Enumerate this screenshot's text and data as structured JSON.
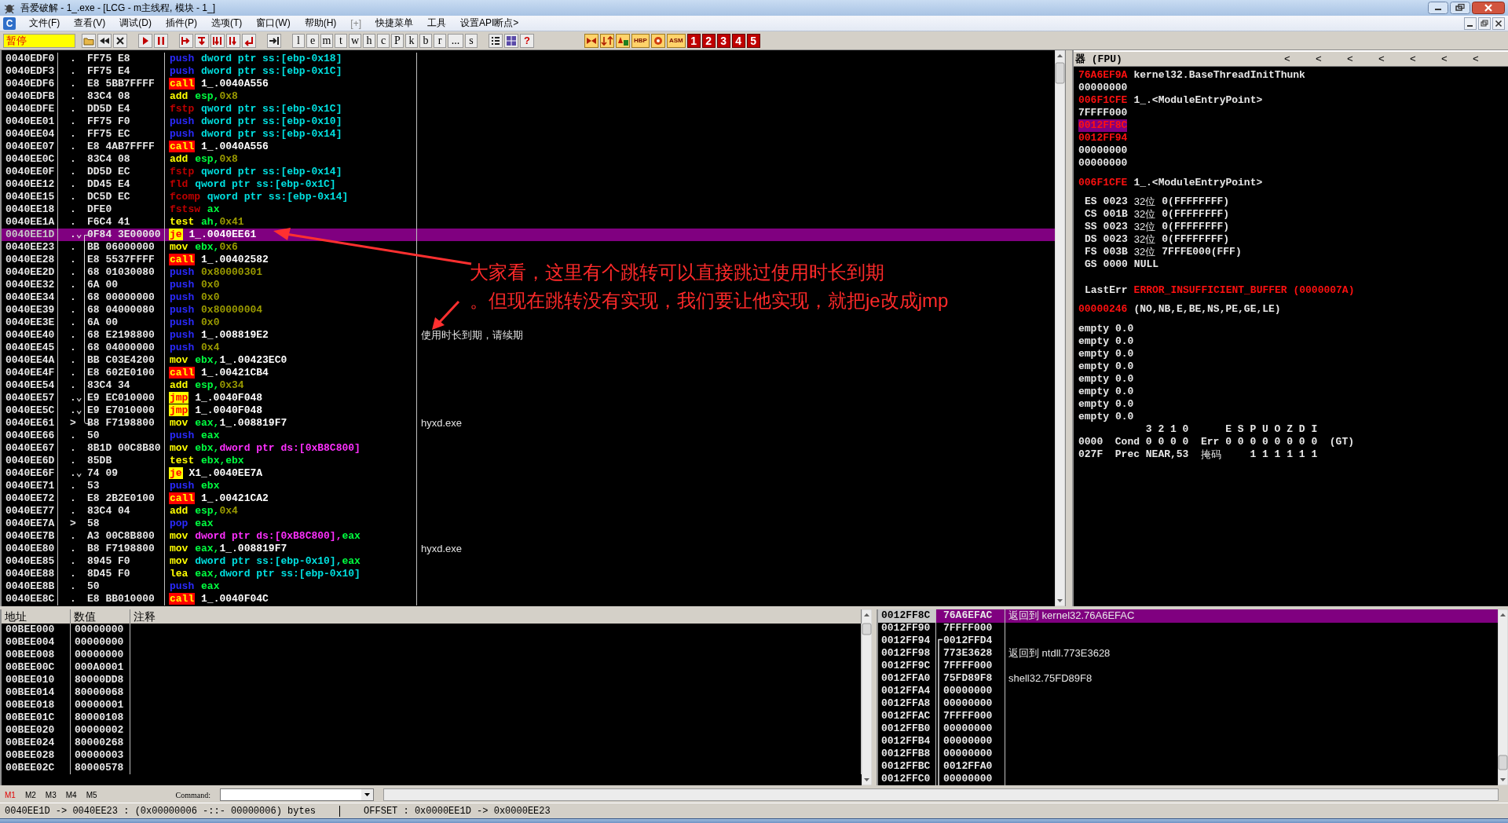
{
  "window": {
    "title": "吾爱破解 - 1_.exe - [LCG - m主线程, 模块 - 1_]"
  },
  "menu": {
    "icon_label": "C",
    "items": [
      "文件(F)",
      "查看(V)",
      "调试(D)",
      "插件(P)",
      "选项(T)",
      "窗口(W)",
      "帮助(H)",
      "[+]",
      "快捷菜单",
      "工具",
      "设置API断点>"
    ]
  },
  "toolbar": {
    "status": "暂停",
    "letter_buttons": [
      "l",
      "e",
      "m",
      "t",
      "w",
      "h",
      "c",
      "P",
      "k",
      "b",
      "r",
      "...",
      "s"
    ],
    "help_button": "?",
    "badge_buttons": [
      "HBP",
      "ASM"
    ],
    "number_buttons": [
      "1",
      "2",
      "3",
      "4",
      "5"
    ]
  },
  "disassembly": {
    "rows": [
      {
        "address": "0040EDF0",
        "marker": ".",
        "hex": "FF75 E8",
        "kind": "push",
        "mnemonic": "push",
        "operands": [
          {
            "text": "dword ptr ss:[ebp-0x18]",
            "kind": "stack"
          }
        ],
        "selected": false,
        "jump_source": false,
        "jump_target": false
      },
      {
        "address": "0040EDF3",
        "marker": ".",
        "hex": "FF75 E4",
        "kind": "push",
        "mnemonic": "push",
        "operands": [
          {
            "text": "dword ptr ss:[ebp-0x1C]",
            "kind": "stack"
          }
        ],
        "selected": false,
        "jump_source": false,
        "jump_target": false
      },
      {
        "address": "0040EDF6",
        "marker": ".",
        "hex": "E8 5BB7FFFF",
        "kind": "call",
        "mnemonic": "call",
        "operands": [
          {
            "text": "1_.0040A556",
            "kind": "addr"
          }
        ],
        "selected": false,
        "jump_source": false,
        "jump_target": false
      },
      {
        "address": "0040EDFB",
        "marker": ".",
        "hex": "83C4 08",
        "kind": "plain",
        "mnemonic": "add",
        "operands": [
          {
            "text": "esp,",
            "kind": "reg"
          },
          {
            "text": "0x8",
            "kind": "const"
          }
        ],
        "selected": false,
        "jump_source": false,
        "jump_target": false
      },
      {
        "address": "0040EDFE",
        "marker": ".",
        "hex": "DD5D E4",
        "kind": "fpu",
        "mnemonic": "fstp",
        "operands": [
          {
            "text": "qword ptr ss:[ebp-0x1C]",
            "kind": "stack"
          }
        ],
        "selected": false,
        "jump_source": false,
        "jump_target": false
      },
      {
        "address": "0040EE01",
        "marker": ".",
        "hex": "FF75 F0",
        "kind": "push",
        "mnemonic": "push",
        "operands": [
          {
            "text": "dword ptr ss:[ebp-0x10]",
            "kind": "stack"
          }
        ],
        "selected": false,
        "jump_source": false,
        "jump_target": false
      },
      {
        "address": "0040EE04",
        "marker": ".",
        "hex": "FF75 EC",
        "kind": "push",
        "mnemonic": "push",
        "operands": [
          {
            "text": "dword ptr ss:[ebp-0x14]",
            "kind": "stack"
          }
        ],
        "selected": false,
        "jump_source": false,
        "jump_target": false
      },
      {
        "address": "0040EE07",
        "marker": ".",
        "hex": "E8 4AB7FFFF",
        "kind": "call",
        "mnemonic": "call",
        "operands": [
          {
            "text": "1_.0040A556",
            "kind": "addr"
          }
        ],
        "selected": false,
        "jump_source": false,
        "jump_target": false
      },
      {
        "address": "0040EE0C",
        "marker": ".",
        "hex": "83C4 08",
        "kind": "plain",
        "mnemonic": "add",
        "operands": [
          {
            "text": "esp,",
            "kind": "reg"
          },
          {
            "text": "0x8",
            "kind": "const"
          }
        ],
        "selected": false,
        "jump_source": false,
        "jump_target": false
      },
      {
        "address": "0040EE0F",
        "marker": ".",
        "hex": "DD5D EC",
        "kind": "fpu",
        "mnemonic": "fstp",
        "operands": [
          {
            "text": "qword ptr ss:[ebp-0x14]",
            "kind": "stack"
          }
        ],
        "selected": false,
        "jump_source": false,
        "jump_target": false
      },
      {
        "address": "0040EE12",
        "marker": ".",
        "hex": "DD45 E4",
        "kind": "fpu",
        "mnemonic": "fld",
        "operands": [
          {
            "text": "qword ptr ss:[ebp-0x1C]",
            "kind": "stack"
          }
        ],
        "selected": false,
        "jump_source": false,
        "jump_target": false
      },
      {
        "address": "0040EE15",
        "marker": ".",
        "hex": "DC5D EC",
        "kind": "fpu",
        "mnemonic": "fcomp",
        "operands": [
          {
            "text": "qword ptr ss:[ebp-0x14]",
            "kind": "stack"
          }
        ],
        "selected": false,
        "jump_source": false,
        "jump_target": false
      },
      {
        "address": "0040EE18",
        "marker": ".",
        "hex": "DFE0",
        "kind": "fpu",
        "mnemonic": "fstsw",
        "operands": [
          {
            "text": "ax",
            "kind": "reg"
          }
        ],
        "selected": false,
        "jump_source": false,
        "jump_target": false
      },
      {
        "address": "0040EE1A",
        "marker": ".",
        "hex": "F6C4 41",
        "kind": "plain",
        "mnemonic": "test",
        "operands": [
          {
            "text": "ah,",
            "kind": "reg"
          },
          {
            "text": "0x41",
            "kind": "const"
          }
        ],
        "selected": false,
        "jump_source": false,
        "jump_target": false
      },
      {
        "address": "0040EE1D",
        "marker": ".⌄",
        "hex": "0F84 3E00000",
        "kind": "jump",
        "mnemonic": "je",
        "operands": [
          {
            "text": "1_.0040EE61",
            "kind": "addr"
          }
        ],
        "selected": true,
        "jump_source": true,
        "jump_target": false
      },
      {
        "address": "0040EE23",
        "marker": ".",
        "hex": "BB 06000000",
        "kind": "plain",
        "mnemonic": "mov",
        "operands": [
          {
            "text": "ebx,",
            "kind": "reg"
          },
          {
            "text": "0x6",
            "kind": "const"
          }
        ],
        "selected": false,
        "jump_source": false,
        "jump_target": false
      },
      {
        "address": "0040EE28",
        "marker": ".",
        "hex": "E8 5537FFFF",
        "kind": "call",
        "mnemonic": "call",
        "operands": [
          {
            "text": "1_.00402582",
            "kind": "addr"
          }
        ],
        "selected": false,
        "jump_source": false,
        "jump_target": false
      },
      {
        "address": "0040EE2D",
        "marker": ".",
        "hex": "68 01030080",
        "kind": "push",
        "mnemonic": "push",
        "operands": [
          {
            "text": "0x80000301",
            "kind": "const"
          }
        ],
        "selected": false,
        "jump_source": false,
        "jump_target": false
      },
      {
        "address": "0040EE32",
        "marker": ".",
        "hex": "6A 00",
        "kind": "push",
        "mnemonic": "push",
        "operands": [
          {
            "text": "0x0",
            "kind": "const"
          }
        ],
        "selected": false,
        "jump_source": false,
        "jump_target": false
      },
      {
        "address": "0040EE34",
        "marker": ".",
        "hex": "68 00000000",
        "kind": "push",
        "mnemonic": "push",
        "operands": [
          {
            "text": "0x0",
            "kind": "const"
          }
        ],
        "selected": false,
        "jump_source": false,
        "jump_target": false
      },
      {
        "address": "0040EE39",
        "marker": ".",
        "hex": "68 04000080",
        "kind": "push",
        "mnemonic": "push",
        "operands": [
          {
            "text": "0x80000004",
            "kind": "const"
          }
        ],
        "selected": false,
        "jump_source": false,
        "jump_target": false
      },
      {
        "address": "0040EE3E",
        "marker": ".",
        "hex": "6A 00",
        "kind": "push",
        "mnemonic": "push",
        "operands": [
          {
            "text": "0x0",
            "kind": "const"
          }
        ],
        "selected": false,
        "jump_source": false,
        "jump_target": false
      },
      {
        "address": "0040EE40",
        "marker": ".",
        "hex": "68 E2198800",
        "kind": "push",
        "mnemonic": "push",
        "operands": [
          {
            "text": "1_.008819E2",
            "kind": "addr"
          }
        ],
        "comment": "使用时长到期，请续期",
        "selected": false,
        "jump_source": false,
        "jump_target": false
      },
      {
        "address": "0040EE45",
        "marker": ".",
        "hex": "68 04000000",
        "kind": "push",
        "mnemonic": "push",
        "operands": [
          {
            "text": "0x4",
            "kind": "const"
          }
        ],
        "selected": false,
        "jump_source": false,
        "jump_target": false
      },
      {
        "address": "0040EE4A",
        "marker": ".",
        "hex": "BB C03E4200",
        "kind": "plain",
        "mnemonic": "mov",
        "operands": [
          {
            "text": "ebx,",
            "kind": "reg"
          },
          {
            "text": "1_.00423EC0",
            "kind": "addr"
          }
        ],
        "selected": false,
        "jump_source": false,
        "jump_target": false
      },
      {
        "address": "0040EE4F",
        "marker": ".",
        "hex": "E8 602E0100",
        "kind": "call",
        "mnemonic": "call",
        "operands": [
          {
            "text": "1_.00421CB4",
            "kind": "addr"
          }
        ],
        "selected": false,
        "jump_source": false,
        "jump_target": false
      },
      {
        "address": "0040EE54",
        "marker": ".",
        "hex": "83C4 34",
        "kind": "plain",
        "mnemonic": "add",
        "operands": [
          {
            "text": "esp,",
            "kind": "reg"
          },
          {
            "text": "0x34",
            "kind": "const"
          }
        ],
        "selected": false,
        "jump_source": false,
        "jump_target": false
      },
      {
        "address": "0040EE57",
        "marker": ".⌄",
        "hex": "E9 EC010000",
        "kind": "jump",
        "mnemonic": "jmp",
        "operands": [
          {
            "text": "1_.0040F048",
            "kind": "addr"
          }
        ],
        "selected": false,
        "jump_source": false,
        "jump_target": false
      },
      {
        "address": "0040EE5C",
        "marker": ".⌄",
        "hex": "E9 E7010000",
        "kind": "jump",
        "mnemonic": "jmp",
        "operands": [
          {
            "text": "1_.0040F048",
            "kind": "addr"
          }
        ],
        "selected": false,
        "jump_source": false,
        "jump_target": false
      },
      {
        "address": "0040EE61",
        "marker": ">",
        "hex": "B8 F7198800",
        "kind": "plain",
        "mnemonic": "mov",
        "operands": [
          {
            "text": "eax,",
            "kind": "reg"
          },
          {
            "text": "1_.008819F7",
            "kind": "addr"
          }
        ],
        "comment": "hyxd.exe",
        "selected": false,
        "jump_source": false,
        "jump_target": true
      },
      {
        "address": "0040EE66",
        "marker": ".",
        "hex": "50",
        "kind": "push",
        "mnemonic": "push",
        "operands": [
          {
            "text": "eax",
            "kind": "reg"
          }
        ],
        "selected": false,
        "jump_source": false,
        "jump_target": false
      },
      {
        "address": "0040EE67",
        "marker": ".",
        "hex": "8B1D 00C8B80",
        "kind": "plain",
        "mnemonic": "mov",
        "operands": [
          {
            "text": "ebx,",
            "kind": "reg"
          },
          {
            "text": "dword ptr ds:[0xB8C800]",
            "kind": "global"
          }
        ],
        "selected": false,
        "jump_source": false,
        "jump_target": false
      },
      {
        "address": "0040EE6D",
        "marker": ".",
        "hex": "85DB",
        "kind": "plain",
        "mnemonic": "test",
        "operands": [
          {
            "text": "ebx,ebx",
            "kind": "reg"
          }
        ],
        "selected": false,
        "jump_source": false,
        "jump_target": false
      },
      {
        "address": "0040EE6F",
        "marker": ".⌄",
        "hex": "74 09",
        "kind": "jump",
        "mnemonic": "je",
        "operands": [
          {
            "text": "X1_.0040EE7A",
            "kind": "addr"
          }
        ],
        "selected": false,
        "jump_source": false,
        "jump_target": false
      },
      {
        "address": "0040EE71",
        "marker": ".",
        "hex": "53",
        "kind": "push",
        "mnemonic": "push",
        "operands": [
          {
            "text": "ebx",
            "kind": "reg"
          }
        ],
        "selected": false,
        "jump_source": false,
        "jump_target": false
      },
      {
        "address": "0040EE72",
        "marker": ".",
        "hex": "E8 2B2E0100",
        "kind": "call",
        "mnemonic": "call",
        "operands": [
          {
            "text": "1_.00421CA2",
            "kind": "addr"
          }
        ],
        "selected": false,
        "jump_source": false,
        "jump_target": false
      },
      {
        "address": "0040EE77",
        "marker": ".",
        "hex": "83C4 04",
        "kind": "plain",
        "mnemonic": "add",
        "operands": [
          {
            "text": "esp,",
            "kind": "reg"
          },
          {
            "text": "0x4",
            "kind": "const"
          }
        ],
        "selected": false,
        "jump_source": false,
        "jump_target": false
      },
      {
        "address": "0040EE7A",
        "marker": ">",
        "hex": "58",
        "kind": "push",
        "mnemonic": "pop",
        "operands": [
          {
            "text": "eax",
            "kind": "reg"
          }
        ],
        "selected": false,
        "jump_source": false,
        "jump_target": false
      },
      {
        "address": "0040EE7B",
        "marker": ".",
        "hex": "A3 00C8B800",
        "kind": "plain",
        "mnemonic": "mov",
        "operands": [
          {
            "text": "dword ptr ds:[0xB8C800],",
            "kind": "global"
          },
          {
            "text": "eax",
            "kind": "reg"
          }
        ],
        "selected": false,
        "jump_source": false,
        "jump_target": false
      },
      {
        "address": "0040EE80",
        "marker": ".",
        "hex": "B8 F7198800",
        "kind": "plain",
        "mnemonic": "mov",
        "operands": [
          {
            "text": "eax,",
            "kind": "reg"
          },
          {
            "text": "1_.008819F7",
            "kind": "addr"
          }
        ],
        "comment": "hyxd.exe",
        "selected": false,
        "jump_source": false,
        "jump_target": false
      },
      {
        "address": "0040EE85",
        "marker": ".",
        "hex": "8945 F0",
        "kind": "plain",
        "mnemonic": "mov",
        "operands": [
          {
            "text": "dword ptr ss:[ebp-0x10],",
            "kind": "stack"
          },
          {
            "text": "eax",
            "kind": "reg"
          }
        ],
        "selected": false,
        "jump_source": false,
        "jump_target": false
      },
      {
        "address": "0040EE88",
        "marker": ".",
        "hex": "8D45 F0",
        "kind": "plain",
        "mnemonic": "lea",
        "operands": [
          {
            "text": "eax,",
            "kind": "reg"
          },
          {
            "text": "dword ptr ss:[ebp-0x10]",
            "kind": "stack"
          }
        ],
        "selected": false,
        "jump_source": false,
        "jump_target": false
      },
      {
        "address": "0040EE8B",
        "marker": ".",
        "hex": "50",
        "kind": "push",
        "mnemonic": "push",
        "operands": [
          {
            "text": "eax",
            "kind": "reg"
          }
        ],
        "selected": false,
        "jump_source": false,
        "jump_target": false
      },
      {
        "address": "0040EE8C",
        "marker": ".",
        "hex": "E8 BB010000",
        "kind": "call",
        "mnemonic": "call",
        "operands": [
          {
            "text": "1_.0040F04C",
            "kind": "addr"
          }
        ],
        "selected": false,
        "jump_source": false,
        "jump_target": false
      }
    ]
  },
  "annotation": {
    "lines": [
      "大家看，这里有个跳转可以直接跳过使用时长到期",
      "。但现在跳转没有实现，我们要让他实现，就把je改成jmp"
    ]
  },
  "registers": {
    "header": "器 (FPU)",
    "scroll_buttons": [
      "<",
      "<",
      "<",
      "<",
      "<",
      "<",
      "<"
    ],
    "general": [
      {
        "value": "76A6EF9A",
        "changed": true,
        "selected": false,
        "comment": "kernel32.BaseThreadInitThunk"
      },
      {
        "value": "00000000",
        "changed": false,
        "selected": false
      },
      {
        "value": "006F1CFE",
        "changed": true,
        "selected": false,
        "comment": "1_.<ModuleEntryPoint>"
      },
      {
        "value": "7FFFF000",
        "changed": false,
        "selected": false
      },
      {
        "value": "0012FF8C",
        "changed": true,
        "selected": true
      },
      {
        "value": "0012FF94",
        "changed": true,
        "selected": false
      },
      {
        "value": "00000000",
        "changed": false,
        "selected": false
      },
      {
        "value": "00000000",
        "changed": false,
        "selected": false
      }
    ],
    "eip": {
      "value": "006F1CFE",
      "changed": true,
      "comment": "1_.<ModuleEntryPoint>"
    },
    "segments": [
      {
        "name": "ES",
        "selector": "0023",
        "bits": "32位",
        "base": "0(FFFFFFFF)"
      },
      {
        "name": "CS",
        "selector": "001B",
        "bits": "32位",
        "base": "0(FFFFFFFF)"
      },
      {
        "name": "SS",
        "selector": "0023",
        "bits": "32位",
        "base": "0(FFFFFFFF)"
      },
      {
        "name": "DS",
        "selector": "0023",
        "bits": "32位",
        "base": "0(FFFFFFFF)"
      },
      {
        "name": "FS",
        "selector": "003B",
        "bits": "32位",
        "base": "7FFFE000(FFF)"
      },
      {
        "name": "GS",
        "selector": "0000",
        "base": "NULL"
      }
    ],
    "last_error": {
      "label": "LastErr",
      "value": "ERROR_INSUFFICIENT_BUFFER (0000007A)"
    },
    "flags": {
      "value": "00000246",
      "changed": true,
      "text": "(NO,NB,E,BE,NS,PE,GE,LE)"
    },
    "fpu": [
      {
        "tag": "empty",
        "value": "0.0"
      },
      {
        "tag": "empty",
        "value": "0.0"
      },
      {
        "tag": "empty",
        "value": "0.0"
      },
      {
        "tag": "empty",
        "value": "0.0"
      },
      {
        "tag": "empty",
        "value": "0.0"
      },
      {
        "tag": "empty",
        "value": "0.0"
      },
      {
        "tag": "empty",
        "value": "0.0"
      },
      {
        "tag": "empty",
        "value": "0.0"
      }
    ],
    "fpu_status": {
      "condition_header": "3 2 1 0",
      "exception_header": "E S P U O Z D I",
      "status_word": "0000",
      "condition_label": "Cond",
      "condition_bits": "0 0 0 0",
      "error_label": "Err",
      "error_bits": "0 0 0 0 0 0 0 0",
      "comparison": "(GT)",
      "control_word": "027F",
      "precision_label": "Prec",
      "precision": "NEAR,53",
      "mask_label": "掩码",
      "mask_bits": "1 1 1 1 1 1"
    }
  },
  "dump": {
    "columns": [
      "地址",
      "数值",
      "注释"
    ],
    "rows": [
      {
        "address": "00BEE000",
        "value": "00000000"
      },
      {
        "address": "00BEE004",
        "value": "00000000"
      },
      {
        "address": "00BEE008",
        "value": "00000000"
      },
      {
        "address": "00BEE00C",
        "value": "000A0001"
      },
      {
        "address": "00BEE010",
        "value": "80000DD8"
      },
      {
        "address": "00BEE014",
        "value": "80000068"
      },
      {
        "address": "00BEE018",
        "value": "00000001"
      },
      {
        "address": "00BEE01C",
        "value": "80000108"
      },
      {
        "address": "00BEE020",
        "value": "00000002"
      },
      {
        "address": "00BEE024",
        "value": "80000268"
      },
      {
        "address": "00BEE028",
        "value": "00000003"
      },
      {
        "address": "00BEE02C",
        "value": "80000578"
      }
    ]
  },
  "stack": {
    "rows": [
      {
        "address": "0012FF8C",
        "value": "76A6EFAC",
        "comment": "返回到 kernel32.76A6EFAC",
        "selected": true,
        "link_start": false
      },
      {
        "address": "0012FF90",
        "value": "7FFFF000",
        "selected": false,
        "link_start": false
      },
      {
        "address": "0012FF94",
        "value": "0012FFD4",
        "selected": false,
        "link_start": true
      },
      {
        "address": "0012FF98",
        "value": "773E3628",
        "comment": "返回到 ntdll.773E3628",
        "selected": false,
        "link_start": false
      },
      {
        "address": "0012FF9C",
        "value": "7FFFF000",
        "selected": false,
        "link_start": false
      },
      {
        "address": "0012FFA0",
        "value": "75FD89F8",
        "comment": "shell32.75FD89F8",
        "selected": false,
        "link_start": false
      },
      {
        "address": "0012FFA4",
        "value": "00000000",
        "selected": false,
        "link_start": false
      },
      {
        "address": "0012FFA8",
        "value": "00000000",
        "selected": false,
        "link_start": false
      },
      {
        "address": "0012FFAC",
        "value": "7FFFF000",
        "selected": false,
        "link_start": false
      },
      {
        "address": "0012FFB0",
        "value": "00000000",
        "selected": false,
        "link_start": false
      },
      {
        "address": "0012FFB4",
        "value": "00000000",
        "selected": false,
        "link_start": false
      },
      {
        "address": "0012FFB8",
        "value": "00000000",
        "selected": false,
        "link_start": false
      },
      {
        "address": "0012FFBC",
        "value": "0012FFA0",
        "selected": false,
        "link_start": false
      },
      {
        "address": "0012FFC0",
        "value": "00000000",
        "selected": false,
        "link_start": false
      }
    ]
  },
  "command_bar": {
    "memory_tabs": [
      {
        "label": "M1",
        "selected": true
      },
      {
        "label": "M2",
        "selected": false
      },
      {
        "label": "M3",
        "selected": false
      },
      {
        "label": "M4",
        "selected": false
      },
      {
        "label": "M5",
        "selected": false
      }
    ],
    "command_label": "Command:"
  },
  "status_bar": {
    "selection": "0040EE1D -> 0040EE23 : (0x00000006 -::- 00000006) bytes",
    "offset": "OFFSET : 0x0000EE1D -> 0x0000EE23"
  }
}
